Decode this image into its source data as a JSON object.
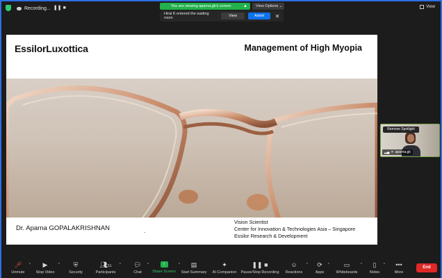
{
  "topbar": {
    "recording_label": "Recording...",
    "viewing_label": "You are viewing aparna.gk's screen",
    "view_options_label": "View Options",
    "view_label": "View"
  },
  "waiting_room": {
    "message": "Hiral K entered the waiting room",
    "view_button": "View",
    "admit_button": "Admit"
  },
  "slide": {
    "logo": "EssilorLuxottica",
    "title": "Management of High Myopia",
    "presenter": "Dr. Aparna GOPALAKRISHNAN",
    "dot": ".",
    "role_lines": [
      "Vision Scientist",
      "Center for Innovation & Technologies Asia – Singapore",
      "Essilor Research & Development"
    ]
  },
  "video_tile": {
    "spotlight_button": "Remove Spotlight",
    "participant_name": "aparna.gk"
  },
  "toolbar": {
    "unmute": "Unmute",
    "stop_video": "Stop Video",
    "security": "Security",
    "participants": "Participants",
    "participants_count": "51",
    "chat": "Chat",
    "share_screen": "Share Screen",
    "start_summary": "Start Summary",
    "ai_companion": "AI Companion",
    "pause_stop_recording": "Pause/Stop Recording",
    "reactions": "Reactions",
    "apps": "Apps",
    "whiteboards": "Whiteboards",
    "notes": "Notes",
    "more": "More",
    "end": "End"
  },
  "colors": {
    "accent_border": "#2f6fe4",
    "green": "#22b14c",
    "admit_blue": "#0e72ed",
    "end_red": "#e02828"
  }
}
